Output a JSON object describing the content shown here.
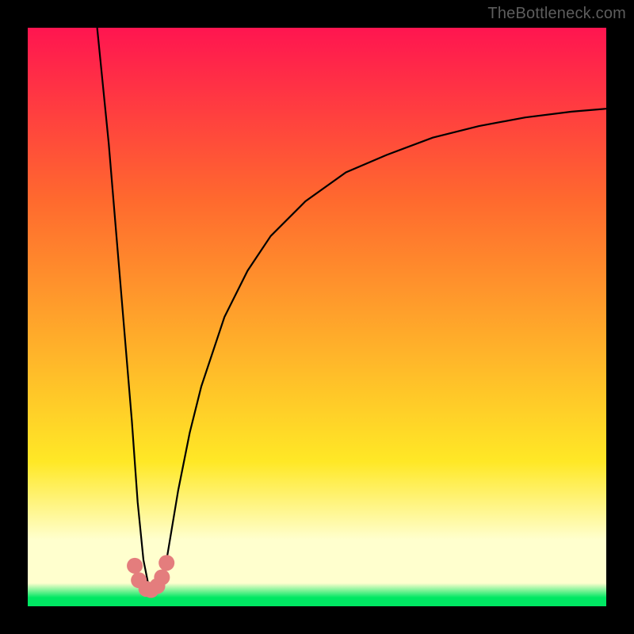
{
  "watermark": "TheBottleneck.com",
  "colors": {
    "bg_black": "#000000",
    "grad_top": "#ff1550",
    "grad_mid1": "#ff6a2e",
    "grad_mid2": "#ffb02a",
    "grad_mid3": "#ffe826",
    "grad_pale": "#ffffce",
    "grad_green": "#00e763",
    "curve": "#000000",
    "marker": "#e47d7d"
  },
  "chart_data": {
    "type": "line",
    "title": "",
    "xlabel": "",
    "ylabel": "",
    "xlim": [
      0,
      100
    ],
    "ylim": [
      0,
      100
    ],
    "series": [
      {
        "name": "bottleneck-curve",
        "x": [
          12,
          14,
          16,
          18,
          19,
          20,
          21,
          22,
          23,
          24,
          26,
          28,
          30,
          34,
          38,
          42,
          48,
          55,
          62,
          70,
          78,
          86,
          94,
          100
        ],
        "y": [
          100,
          80,
          56,
          32,
          18,
          8,
          3,
          2,
          3,
          8,
          20,
          30,
          38,
          50,
          58,
          64,
          70,
          75,
          78,
          81,
          83,
          84.5,
          85.5,
          86
        ]
      }
    ],
    "markers": {
      "name": "cluster-points",
      "x": [
        18.5,
        19.2,
        20.5,
        21.3,
        22.4,
        23.2,
        24.0
      ],
      "y": [
        7,
        4.5,
        3,
        2.8,
        3.5,
        5,
        7.5
      ]
    },
    "gradient_stops": [
      {
        "offset": 0.0,
        "key": "grad_top"
      },
      {
        "offset": 0.3,
        "key": "grad_mid1"
      },
      {
        "offset": 0.55,
        "key": "grad_mid2"
      },
      {
        "offset": 0.75,
        "key": "grad_mid3"
      },
      {
        "offset": 0.885,
        "key": "grad_pale"
      },
      {
        "offset": 0.96,
        "key": "grad_pale"
      },
      {
        "offset": 0.985,
        "key": "grad_green"
      },
      {
        "offset": 1.0,
        "key": "grad_green"
      }
    ]
  }
}
